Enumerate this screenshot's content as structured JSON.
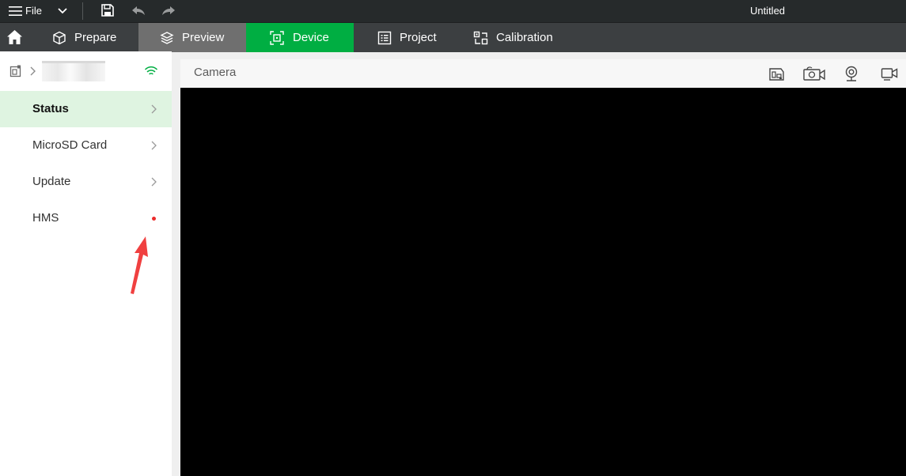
{
  "titlebar": {
    "file_label": "File",
    "document_title": "Untitled"
  },
  "tabs": [
    {
      "label": "Prepare",
      "icon": "cube-icon",
      "state": "normal"
    },
    {
      "label": "Preview",
      "icon": "layers-icon",
      "state": "hover"
    },
    {
      "label": "Device",
      "icon": "device-icon",
      "state": "selected"
    },
    {
      "label": "Project",
      "icon": "project-list-icon",
      "state": "normal"
    },
    {
      "label": "Calibration",
      "icon": "calibration-icon",
      "state": "normal"
    }
  ],
  "sidebar": {
    "device": {
      "connection": "wifi-icon"
    },
    "items": [
      {
        "label": "Status",
        "active": true,
        "indicator": "chevron"
      },
      {
        "label": "MicroSD Card",
        "active": false,
        "indicator": "chevron"
      },
      {
        "label": "Update",
        "active": false,
        "indicator": "chevron"
      },
      {
        "label": "HMS",
        "active": false,
        "indicator": "red-dot"
      }
    ]
  },
  "camera": {
    "title": "Camera",
    "toolbar_icons": [
      "storage-icon",
      "timelapse-camera-icon",
      "webcam-icon",
      "video-camera-icon"
    ]
  },
  "colors": {
    "accent": "#00ae42",
    "titlebar_bg": "#262a2b",
    "tabbar_bg": "#3c3f41",
    "active_item_bg": "#dff4e1",
    "notification_dot": "#ec2b2b",
    "annotation_arrow": "#f04040",
    "camera_view": "#000000"
  }
}
